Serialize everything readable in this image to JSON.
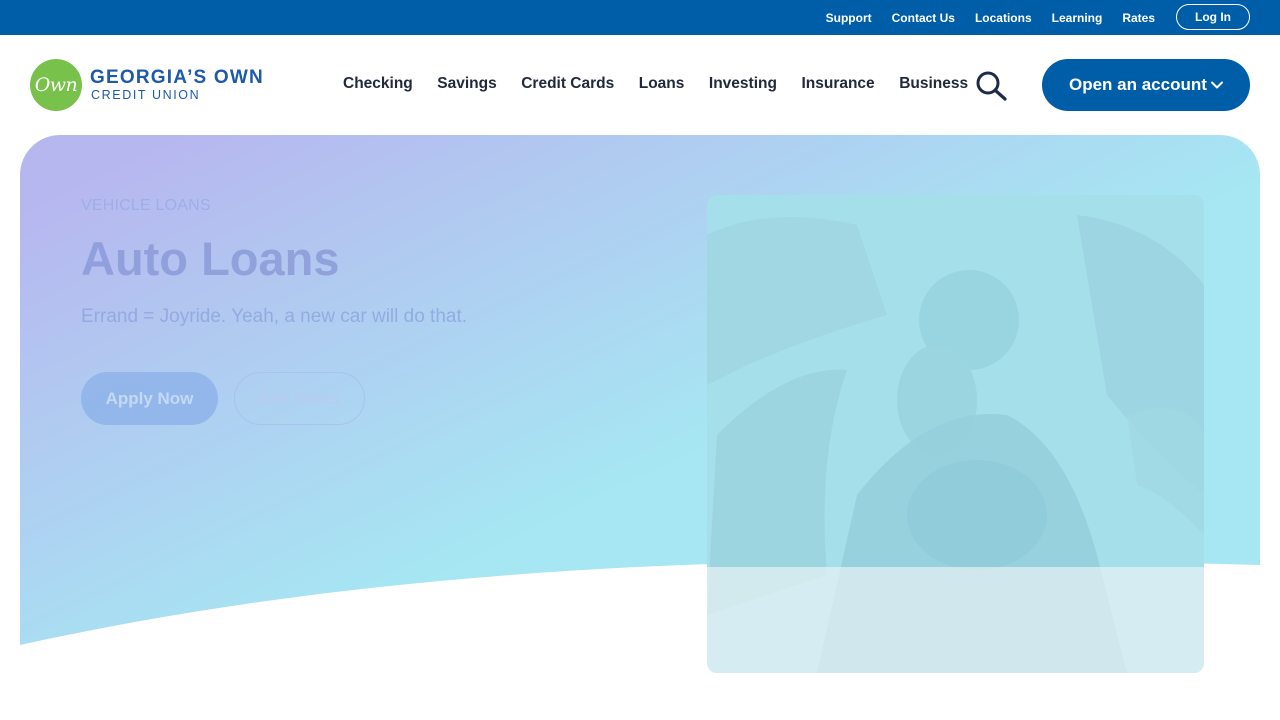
{
  "utility": {
    "links": [
      "Support",
      "Contact Us",
      "Locations",
      "Learning",
      "Rates"
    ],
    "login_label": "Log In"
  },
  "brand": {
    "badge_text": "Own",
    "name_line1": "GEORGIA’S OWN",
    "name_line2": "CREDIT UNION",
    "colors": {
      "primary": "#005da8",
      "badge": "#78c14b"
    }
  },
  "nav": {
    "items": [
      "Checking",
      "Savings",
      "Credit Cards",
      "Loans",
      "Investing",
      "Insurance",
      "Business"
    ],
    "search_icon": "search-icon",
    "open_account_label": "Open an account"
  },
  "hero": {
    "eyebrow": "VEHICLE LOANS",
    "title": "Auto Loans",
    "subtitle": "Errand = Joyride. Yeah, a new car will do that.",
    "apply_label": "Apply Now",
    "rates_label": "See Rates",
    "gradient": {
      "from": "#b7b7ef",
      "to": "#a6e7f3"
    }
  }
}
